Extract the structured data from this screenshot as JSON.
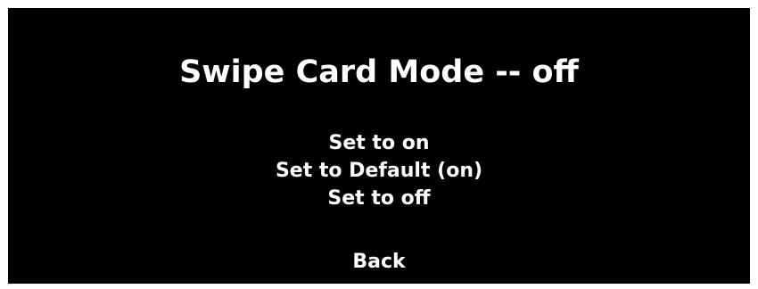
{
  "screen": {
    "title": "Swipe Card Mode -- off",
    "options": [
      {
        "label": "Set to on"
      },
      {
        "label": "Set to Default (on)"
      },
      {
        "label": "Set to off"
      }
    ],
    "back_label": "Back"
  },
  "colors": {
    "background": "#000000",
    "text": "#ffffff",
    "frame": "#ffffff"
  }
}
